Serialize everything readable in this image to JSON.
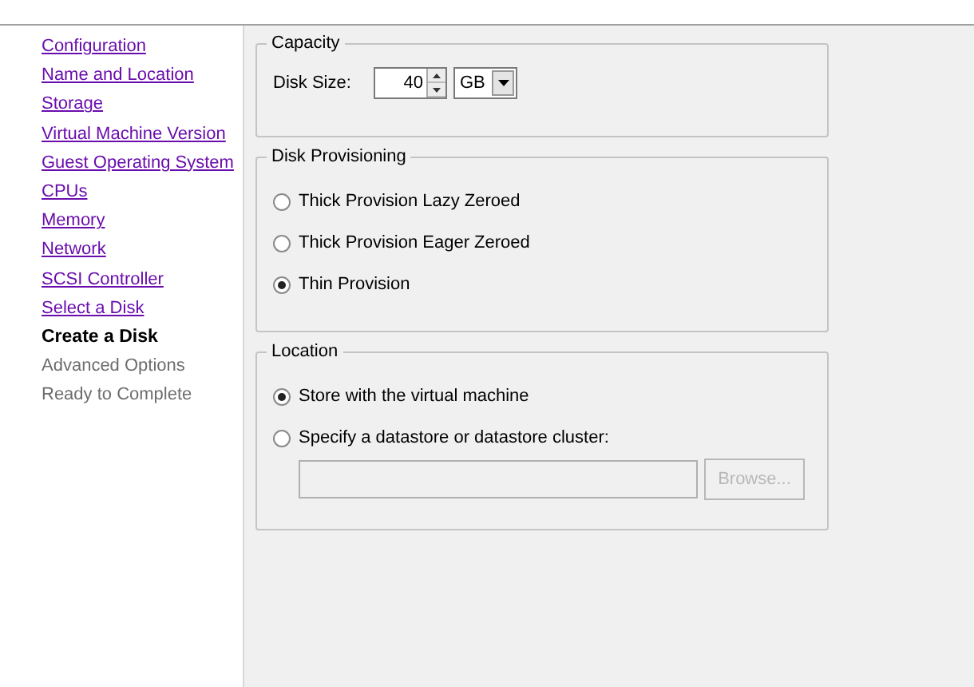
{
  "steps": [
    {
      "label": "Configuration",
      "kind": "done"
    },
    {
      "label": "Name and Location",
      "kind": "done"
    },
    {
      "label": "Storage",
      "kind": "done"
    },
    {
      "label": "Virtual Machine Version",
      "kind": "done"
    },
    {
      "label": "Guest Operating System",
      "kind": "done"
    },
    {
      "label": "CPUs",
      "kind": "done"
    },
    {
      "label": "Memory",
      "kind": "done"
    },
    {
      "label": "Network",
      "kind": "done"
    },
    {
      "label": "SCSI Controller",
      "kind": "done"
    },
    {
      "label": "Select a Disk",
      "kind": "done"
    },
    {
      "label": "Create a Disk",
      "kind": "current"
    },
    {
      "label": "Advanced Options",
      "kind": "pending"
    },
    {
      "label": "Ready to Complete",
      "kind": "pending"
    }
  ],
  "capacity": {
    "title": "Capacity",
    "label": "Disk Size:",
    "value": "40",
    "unit": "GB"
  },
  "provisioning": {
    "title": "Disk Provisioning",
    "options": [
      {
        "label": "Thick Provision Lazy Zeroed",
        "selected": false
      },
      {
        "label": "Thick Provision Eager Zeroed",
        "selected": false
      },
      {
        "label": "Thin Provision",
        "selected": true
      }
    ]
  },
  "location": {
    "title": "Location",
    "options": [
      {
        "label": "Store with the virtual machine",
        "selected": true
      },
      {
        "label": "Specify a datastore or datastore cluster:",
        "selected": false
      }
    ],
    "browse": {
      "label": "Browse...",
      "disabled": true
    },
    "datastore_field": {
      "disabled": true
    }
  }
}
